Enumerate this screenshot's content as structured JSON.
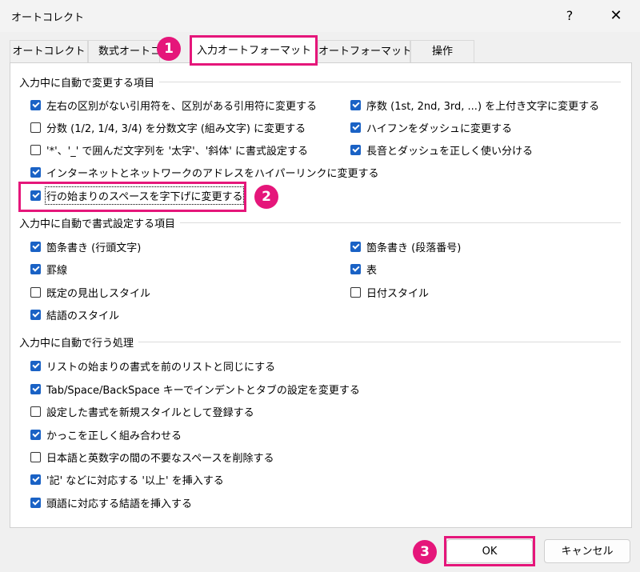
{
  "window": {
    "title": "オートコレクト",
    "help": "?",
    "close": "✕"
  },
  "tabs": [
    "オートコレクト",
    "数式オートコ",
    "入力オートフォーマット",
    "オートフォーマット",
    "操作"
  ],
  "badges": [
    "1",
    "2",
    "3"
  ],
  "groups": [
    {
      "title": "入力中に自動で変更する項目",
      "options": [
        {
          "label": "左右の区別がない引用符を、区別がある引用符に変更する",
          "checked": true
        },
        {
          "label": "序数 (1st, 2nd, 3rd, ...) を上付き文字に変更する",
          "checked": true
        },
        {
          "label": "分数 (1/2, 1/4, 3/4) を分数文字 (組み文字) に変更する",
          "checked": false
        },
        {
          "label": "ハイフンをダッシュに変更する",
          "checked": true
        },
        {
          "label": "'*'、'_' で囲んだ文字列を '太字'、'斜体' に書式設定する",
          "checked": false
        },
        {
          "label": "長音とダッシュを正しく使い分ける",
          "checked": true
        },
        {
          "label": "インターネットとネットワークのアドレスをハイパーリンクに変更する",
          "checked": true
        },
        {
          "label": "行の始まりのスペースを字下げに変更する",
          "checked": true
        }
      ]
    },
    {
      "title": "入力中に自動で書式設定する項目",
      "options": [
        {
          "label": "箇条書き (行頭文字)",
          "checked": true
        },
        {
          "label": "箇条書き (段落番号)",
          "checked": true
        },
        {
          "label": "罫線",
          "checked": true
        },
        {
          "label": "表",
          "checked": true
        },
        {
          "label": "既定の見出しスタイル",
          "checked": false
        },
        {
          "label": "日付スタイル",
          "checked": false
        },
        {
          "label": "結語のスタイル",
          "checked": true
        }
      ]
    },
    {
      "title": "入力中に自動で行う処理",
      "options": [
        {
          "label": "リストの始まりの書式を前のリストと同じにする",
          "checked": true
        },
        {
          "label": "Tab/Space/BackSpace キーでインデントとタブの設定を変更する",
          "checked": true
        },
        {
          "label": "設定した書式を新規スタイルとして登録する",
          "checked": false
        },
        {
          "label": "かっこを正しく組み合わせる",
          "checked": true
        },
        {
          "label": "日本語と英数字の間の不要なスペースを削除する",
          "checked": false
        },
        {
          "label": "'記' などに対応する '以上' を挿入する",
          "checked": true
        },
        {
          "label": "頭語に対応する結語を挿入する",
          "checked": true
        }
      ]
    }
  ],
  "buttons": {
    "ok": "OK",
    "cancel": "キャンセル"
  }
}
